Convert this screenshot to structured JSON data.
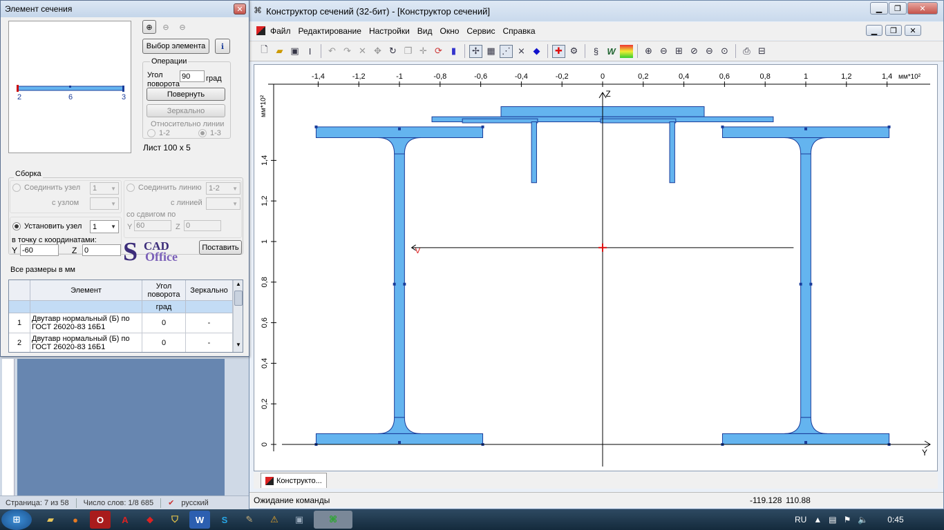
{
  "word": {
    "status_page": "Страница: 7 из 58",
    "status_words": "Число слов: 1/8 685",
    "status_lang": "русский"
  },
  "main_window": {
    "title": "Конструктор сечений (32-бит) - [Конструктор сечений]",
    "menu": [
      "Файл",
      "Редактирование",
      "Настройки",
      "Вид",
      "Окно",
      "Сервис",
      "Справка"
    ],
    "doc_tab": "Конструкто...",
    "status": "Ожидание команды",
    "coord_y": "-119.128",
    "coord_z": "110.88"
  },
  "canvas": {
    "y_ticks": [
      "-1,4",
      "-1,2",
      "-1",
      "-0,8",
      "-0,6",
      "-0,4",
      "-0,2",
      "0",
      "0,2",
      "0,4",
      "0,6",
      "0,8",
      "1",
      "1,2",
      "1,4"
    ],
    "z_ticks": [
      "0",
      "0,2",
      "0,4",
      "0,6",
      "0,8",
      "1",
      "1,2",
      "1,4"
    ],
    "y_unit": "мм*10²",
    "z_unit": "мм*10²",
    "y_axis": "Y",
    "z_axis": "Z",
    "marker": "V",
    "fill_color": "#64b4ef",
    "stroke_color": "#1a3c9a"
  },
  "element_window": {
    "title": "Элемент сечения",
    "preview_labels": [
      "2",
      "6",
      "3"
    ],
    "select_button": "Выбор элемента",
    "operations": {
      "label": "Операции",
      "angle_label_1": "Угол",
      "angle_label_2": "поворота",
      "angle_value": "90",
      "angle_unit": "град",
      "rotate_button": "Повернуть",
      "mirror_button": "Зеркально",
      "relative_label": "Относительно линии",
      "opt1": "1-2",
      "opt2": "1-3"
    },
    "element_name": "Лист 100 x 5",
    "assembly": {
      "label": "Сборка",
      "join_node": "Соединить узел",
      "join_node_value": "1",
      "with_node": "с узлом",
      "join_line": "Соединить линию",
      "join_line_value": "1-2",
      "with_line": "с линией",
      "offset_label": "со сдвигом по",
      "offset_y_label": "Y",
      "offset_y": "60",
      "offset_z_label": "Z",
      "offset_z": "0",
      "set_node": "Установить узел",
      "set_node_value": "1",
      "to_point": "в точку с координатами:",
      "y_label": "Y",
      "y_value": "-60",
      "z_label": "Z",
      "z_value": "0",
      "place_button": "Поставить",
      "logo_top": "CAD",
      "logo_bottom": "Office"
    },
    "sizes_note": "Все размеры в мм",
    "table": {
      "headers": [
        "Элемент",
        "Угол поворота",
        "Зеркально"
      ],
      "units": [
        "",
        "град",
        ""
      ],
      "rows": [
        {
          "num": "1",
          "element": "Двутавр нормальный (Б) по ГОСТ 26020-83 16Б1",
          "angle": "0",
          "mirror": "-"
        },
        {
          "num": "2",
          "element": "Двутавр нормальный (Б) по ГОСТ 26020-83 16Б1",
          "angle": "0",
          "mirror": "-"
        }
      ]
    }
  },
  "taskbar": {
    "lang": "RU",
    "time": "0:45"
  }
}
